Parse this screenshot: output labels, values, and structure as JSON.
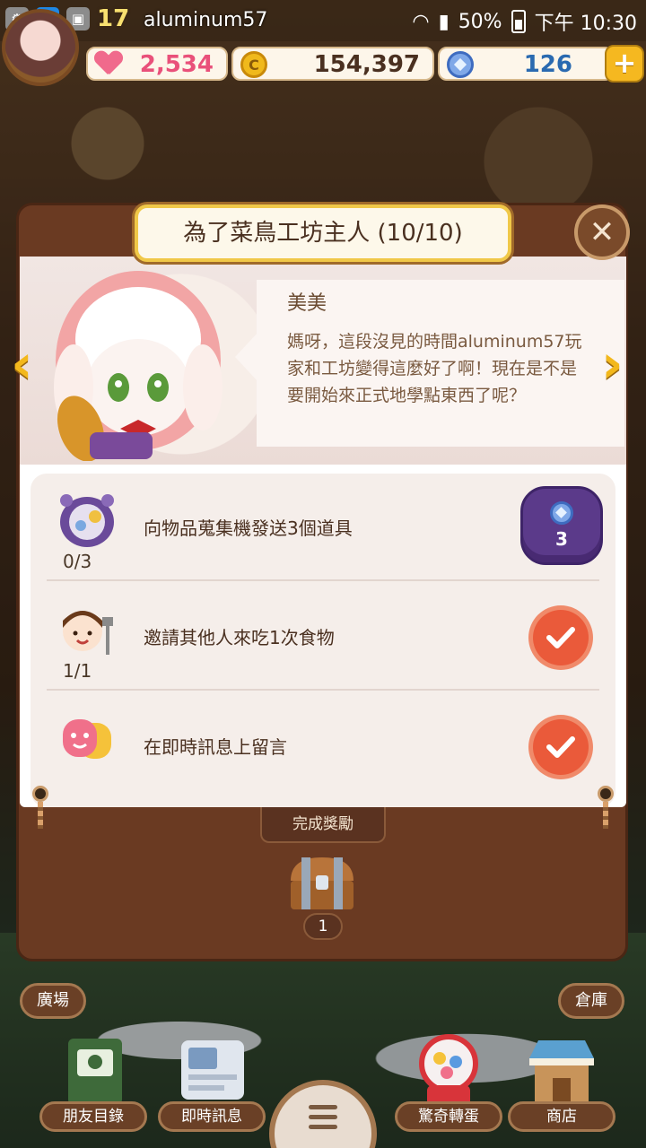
{
  "status_bar": {
    "left_icons": [
      "settings-icon",
      "paste-icon",
      "image-icon"
    ],
    "paste_glyph": "贴",
    "battery": "50%",
    "time": "下午 10:30"
  },
  "player": {
    "level": "17",
    "name": "aluminum57"
  },
  "currencies": {
    "hearts": "2,534",
    "coins": "154,397",
    "gems": "126",
    "coin_glyph": "C",
    "plus": "+"
  },
  "dialog": {
    "title": "為了菜鳥工坊主人 (10/10)",
    "close": "✕",
    "prev_arrow": "‹",
    "next_arrow": "›",
    "speaker": "美美",
    "speech": "媽呀，這段沒見的時間aluminum57玩家和工坊變得這麼好了啊！現在是不是要開始來正式地學點東西了呢？"
  },
  "tasks": [
    {
      "text": "向物品蒐集機發送3個道具",
      "progress": "0/3",
      "reward_gems": "3",
      "completed": false
    },
    {
      "text": "邀請其他人來吃1次食物",
      "progress": "1/1",
      "completed": true
    },
    {
      "text": "在即時訊息上留言",
      "progress": "",
      "completed": true
    }
  ],
  "completion_reward": {
    "label": "完成獎勵",
    "chest_count": "1"
  },
  "bottom_nav": {
    "plaza": "廣場",
    "warehouse": "倉庫",
    "friends": "朋友目錄",
    "messages": "即時訊息",
    "gacha": "驚奇轉蛋",
    "shop": "商店"
  },
  "colors": {
    "accent_gold": "#f3b81c",
    "panel_brown": "#6a3a22",
    "reward_purple": "#5b3a8a",
    "check_red": "#ea5a3a",
    "heart_pink": "#f06a8c"
  }
}
